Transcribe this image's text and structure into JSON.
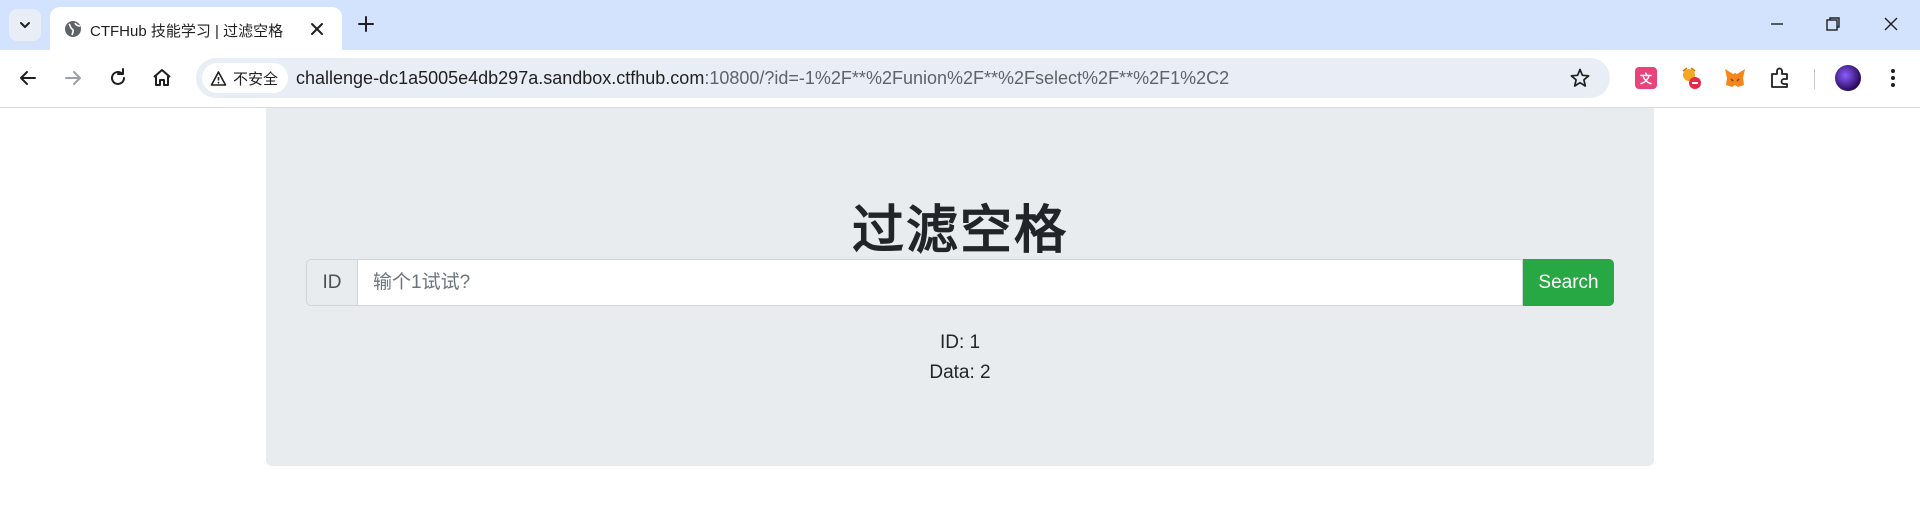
{
  "browser": {
    "tab": {
      "title": "CTFHub 技能学习 | 过滤空格"
    },
    "address": {
      "security_label": "不安全",
      "host": "challenge-dc1a5005e4db297a.sandbox.ctfhub.com",
      "rest": ":10800/?id=-1%2F**%2Funion%2F**%2Fselect%2F**%2F1%2C2"
    }
  },
  "page": {
    "heading": "过滤空格",
    "input_group": {
      "prepend_label": "ID",
      "input_placeholder": "输个1试试?",
      "input_value": "",
      "search_label": "Search"
    },
    "results": [
      {
        "text": "ID: 1"
      },
      {
        "text": "Data: 2"
      }
    ]
  },
  "colors": {
    "tabstrip": "#d3e3fd",
    "jumbotron": "#e9ecef",
    "search_button": "#28a745"
  }
}
